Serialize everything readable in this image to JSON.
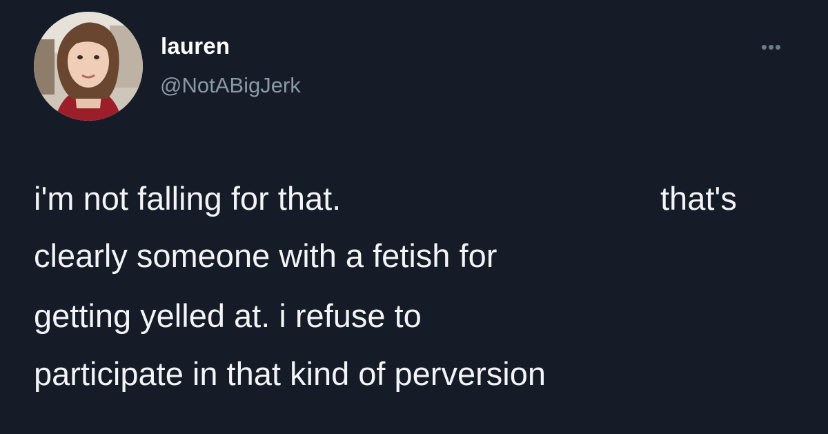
{
  "tweet": {
    "author": {
      "display_name": "lauren",
      "handle": "@NotABigJerk",
      "avatar_icon": "user-avatar-photo"
    },
    "more_icon": "more-options-icon",
    "more_label": "•••",
    "text_lines": {
      "line1_left": "i'm not falling for that.",
      "line1_right": "that's",
      "line2": "clearly someone with a fetish for",
      "line3": "getting yelled at. i refuse to",
      "line4": "participate in that kind of perversion"
    }
  },
  "colors": {
    "background": "#151c28",
    "primary_text": "#ffffff",
    "secondary_text": "#8b98a5"
  }
}
